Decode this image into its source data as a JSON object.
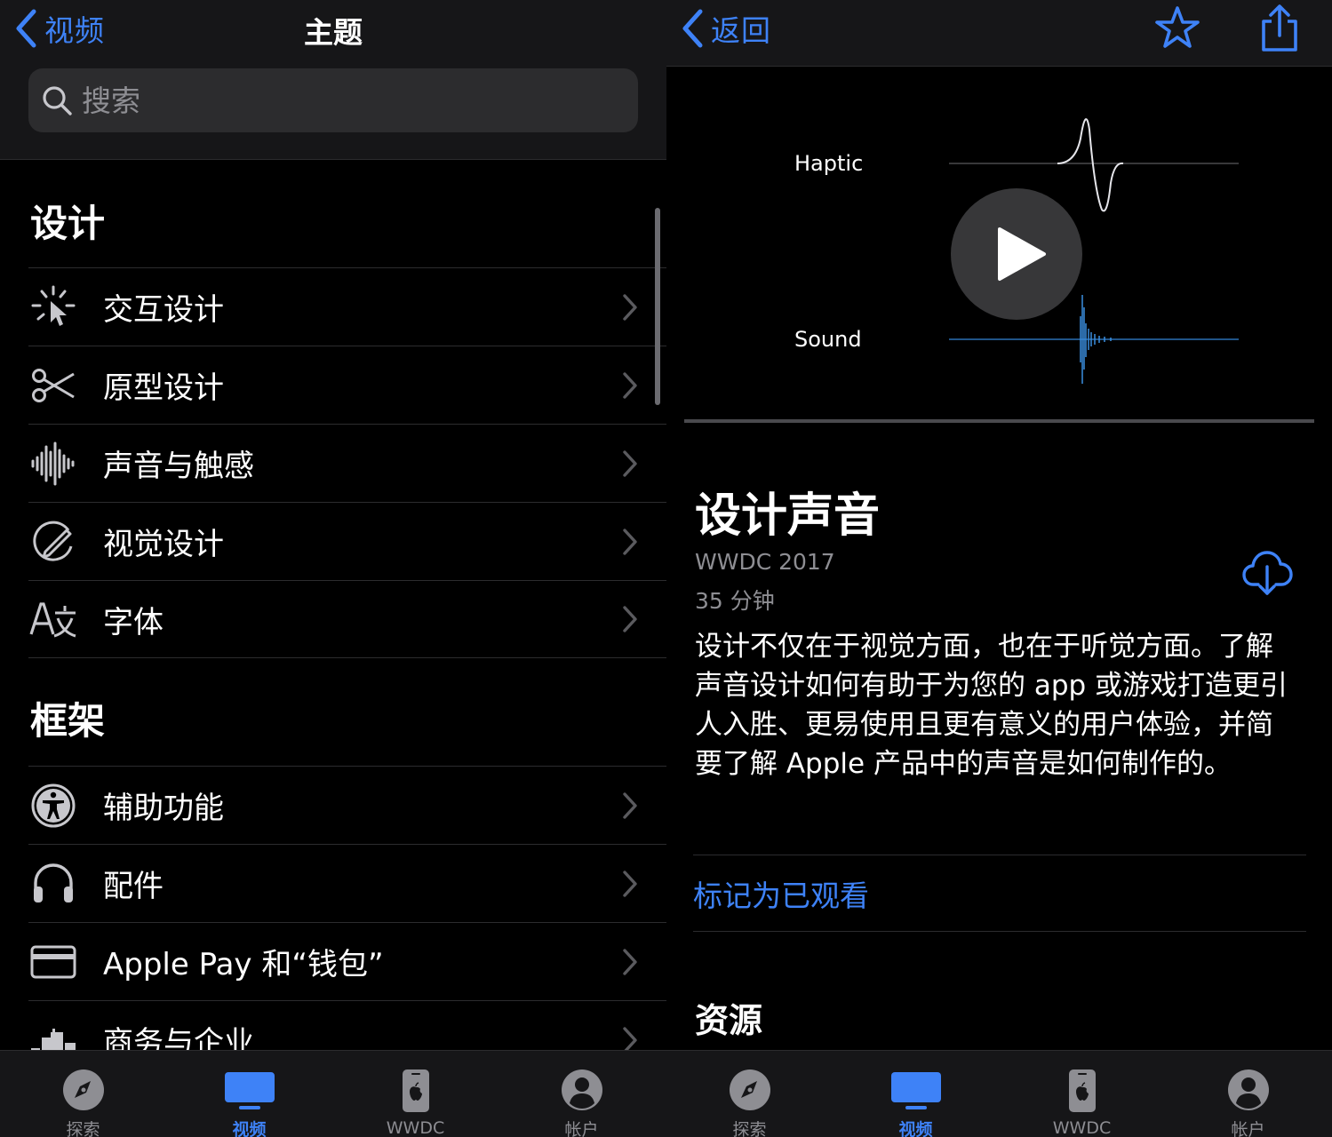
{
  "left": {
    "back_label": "视频",
    "title": "主题",
    "search_placeholder": "搜索",
    "sections": [
      {
        "title": "设计",
        "items": [
          {
            "label": "交互设计",
            "icon": "interaction-icon"
          },
          {
            "label": "原型设计",
            "icon": "scissors-icon"
          },
          {
            "label": "声音与触感",
            "icon": "waveform-icon"
          },
          {
            "label": "视觉设计",
            "icon": "visual-design-icon"
          },
          {
            "label": "字体",
            "icon": "font-icon"
          }
        ]
      },
      {
        "title": "框架",
        "items": [
          {
            "label": "辅助功能",
            "icon": "accessibility-icon"
          },
          {
            "label": "配件",
            "icon": "headphones-icon"
          },
          {
            "label": "Apple Pay 和“钱包”",
            "icon": "card-icon"
          },
          {
            "label": "商务与企业",
            "icon": "building-icon"
          }
        ]
      }
    ]
  },
  "right": {
    "back_label": "返回",
    "video": {
      "haptic_label": "Haptic",
      "sound_label": "Sound"
    },
    "title": "设计声音",
    "event": "WWDC 2017",
    "duration": "35 分钟",
    "description": "设计不仅在于视觉方面，也在于听觉方面。了解声音设计如何有助于为您的 app 或游戏打造更引人入胜、更易使用且更有意义的用户体验，并简要了解 Apple 产品中的声音是如何制作的。",
    "mark_watched": "标记为已观看",
    "resources_title": "资源"
  },
  "tabbar": {
    "tabs": [
      {
        "label": "探索",
        "icon": "compass-icon"
      },
      {
        "label": "视频",
        "icon": "video-icon",
        "active": true
      },
      {
        "label": "WWDC",
        "icon": "wwdc-icon"
      },
      {
        "label": "帐户",
        "icon": "account-icon"
      }
    ]
  },
  "colors": {
    "accent": "#3e82f7",
    "background": "#000000",
    "bar": "#161618",
    "secondary_text": "#8e8e93"
  }
}
